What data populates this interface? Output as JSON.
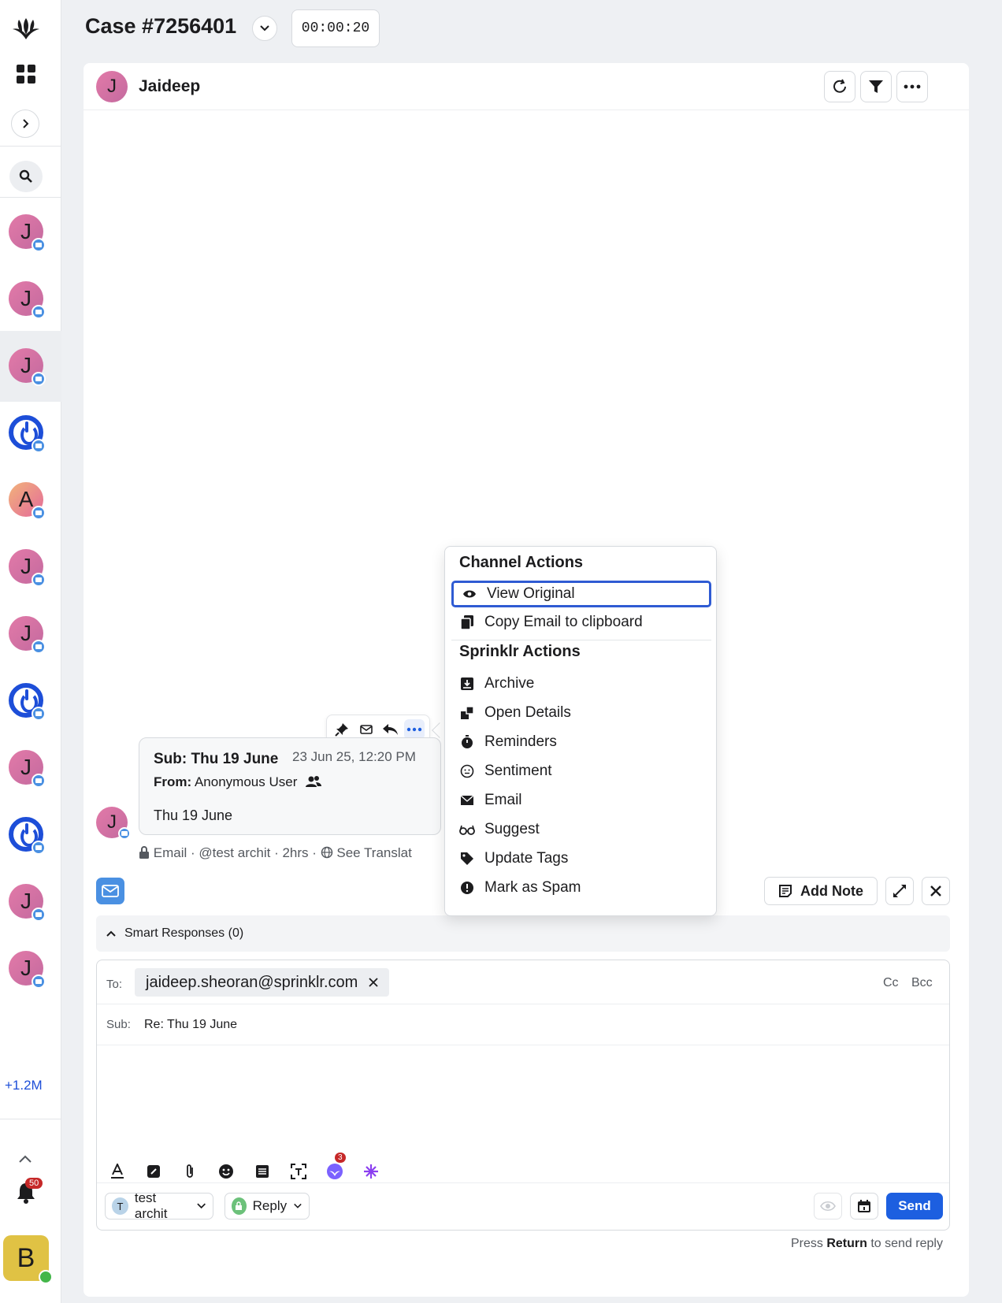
{
  "header": {
    "case_title": "Case #7256401",
    "timer": "00:00:20"
  },
  "rail": {
    "conversations": [
      {
        "initial": "J",
        "kind": "user"
      },
      {
        "initial": "J",
        "kind": "user"
      },
      {
        "initial": "J",
        "kind": "user",
        "active": true
      },
      {
        "initial": "",
        "kind": "brand"
      },
      {
        "initial": "A",
        "kind": "user"
      },
      {
        "initial": "J",
        "kind": "user"
      },
      {
        "initial": "J",
        "kind": "user"
      },
      {
        "initial": "",
        "kind": "brand"
      },
      {
        "initial": "J",
        "kind": "user"
      },
      {
        "initial": "",
        "kind": "brand"
      },
      {
        "initial": "J",
        "kind": "user"
      },
      {
        "initial": "J",
        "kind": "user"
      }
    ],
    "more_count": "+1.2M",
    "notifications": "50",
    "user_initial": "B"
  },
  "panel": {
    "contact_initial": "J",
    "contact_name": "Jaideep"
  },
  "message": {
    "subject": "Sub: Thu 19 June",
    "time": "23 Jun 25, 12:20 PM",
    "from_label": "From:",
    "from_value": "Anonymous User",
    "body": "Thu 19 June",
    "avatar_initial": "J",
    "meta": {
      "channel": "Email",
      "account": "@test archit",
      "age": "2hrs",
      "translate": "See Translat"
    }
  },
  "menu": {
    "channel_heading": "Channel Actions",
    "channel_items": [
      {
        "label": "View Original",
        "icon": "eye-icon"
      },
      {
        "label": "Copy Email to clipboard",
        "icon": "copy-icon"
      }
    ],
    "sprinklr_heading": "Sprinklr Actions",
    "sprinklr_items": [
      {
        "label": "Archive",
        "icon": "archive-icon"
      },
      {
        "label": "Open Details",
        "icon": "details-icon"
      },
      {
        "label": "Reminders",
        "icon": "timer-icon"
      },
      {
        "label": "Sentiment",
        "icon": "sentiment-icon"
      },
      {
        "label": "Email",
        "icon": "envelope-icon"
      },
      {
        "label": "Suggest",
        "icon": "glasses-icon"
      },
      {
        "label": "Update Tags",
        "icon": "tag-icon"
      },
      {
        "label": "Mark as Spam",
        "icon": "alert-icon"
      }
    ]
  },
  "reply": {
    "add_note": "Add Note",
    "smart_responses": "Smart Responses (0)",
    "to_label": "To:",
    "to_email": "jaideep.sheoran@sprinklr.com",
    "cc": "Cc",
    "bcc": "Bcc",
    "sub_label": "Sub:",
    "sub_value": "Re: Thu 19 June",
    "ai_badge": "3",
    "account_initial": "T",
    "account_name": "test archit",
    "mode": "Reply",
    "send": "Send",
    "hint_prefix": "Press ",
    "hint_key": "Return",
    "hint_suffix": " to send reply"
  },
  "colors": {
    "accent": "#1d5fe0",
    "brand": "#1d4ed8",
    "badge": "#c62828",
    "online": "#43b649"
  }
}
